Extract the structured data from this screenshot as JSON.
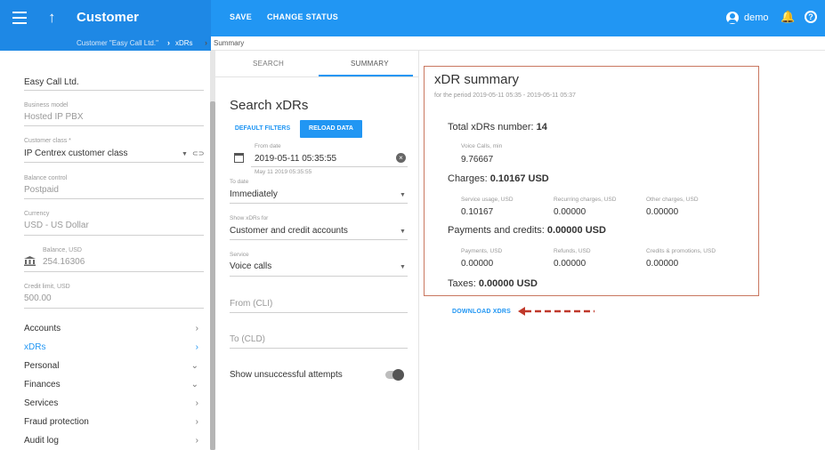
{
  "topbar": {
    "title": "Customer",
    "save": "SAVE",
    "change_status": "CHANGE STATUS",
    "user": "demo",
    "help": "?"
  },
  "breadcrumb": {
    "customer": "Customer \"Easy Call Ltd.\"",
    "xdrs": "xDRs",
    "summary": "Summary"
  },
  "left": {
    "name": "Easy Call Ltd.",
    "business_model_label": "Business model",
    "business_model": "Hosted IP PBX",
    "customer_class_label": "Customer class *",
    "customer_class": "IP Centrex customer class",
    "balance_control_label": "Balance control",
    "balance_control": "Postpaid",
    "currency_label": "Currency",
    "currency": "USD - US Dollar",
    "balance_label": "Balance, USD",
    "balance": "254.16306",
    "credit_limit_label": "Credit limit, USD",
    "credit_limit": "500.00",
    "nav": [
      {
        "label": "Accounts",
        "chev": "›"
      },
      {
        "label": "xDRs",
        "chev": "›"
      },
      {
        "label": "Personal",
        "chev": "⌄"
      },
      {
        "label": "Finances",
        "chev": "⌄"
      },
      {
        "label": "Services",
        "chev": "›"
      },
      {
        "label": "Fraud protection",
        "chev": "›"
      },
      {
        "label": "Audit log",
        "chev": "›"
      }
    ]
  },
  "middle": {
    "tab_search": "SEARCH",
    "tab_summary": "SUMMARY",
    "title": "Search xDRs",
    "default_filters": "DEFAULT FILTERS",
    "reload_data": "RELOAD DATA",
    "from_date_label": "From date",
    "from_date": "2019-05-11 05:35:55",
    "from_date_hint": "May 11 2019 05:35:55",
    "to_date_label": "To date",
    "to_date": "Immediately",
    "show_for_label": "Show xDRs for",
    "show_for": "Customer and credit accounts",
    "service_label": "Service",
    "service": "Voice calls",
    "from_cli_placeholder": "From (CLI)",
    "to_cld_placeholder": "To (CLD)",
    "unsuccessful_label": "Show unsuccessful attempts"
  },
  "summary": {
    "title": "xDR summary",
    "period": "for the period 2019-05-11 05:35 - 2019-05-11 05:37",
    "total_label": "Total xDRs number: ",
    "total_value": "14",
    "voice_label": "Voice Calls, min",
    "voice_value": "9.76667",
    "charges_label": "Charges: ",
    "charges_value": "0.10167 USD",
    "service_usage_label": "Service usage, USD",
    "service_usage_value": "0.10167",
    "recurring_label": "Recurring charges, USD",
    "recurring_value": "0.00000",
    "other_label": "Other charges, USD",
    "other_value": "0.00000",
    "payments_credits_label": "Payments and credits: ",
    "payments_credits_value": "0.00000 USD",
    "payments_label": "Payments, USD",
    "payments_value": "0.00000",
    "refunds_label": "Refunds, USD",
    "refunds_value": "0.00000",
    "credits_promo_label": "Credits & promotions, USD",
    "credits_promo_value": "0.00000",
    "taxes_label": "Taxes: ",
    "taxes_value": "0.00000 USD",
    "download": "DOWNLOAD XDRS",
    "annotation_color": "#c0392b"
  },
  "colors": {
    "primary": "#2196f3",
    "topbar_left": "#1e88e5",
    "summary_border": "#c97760"
  }
}
